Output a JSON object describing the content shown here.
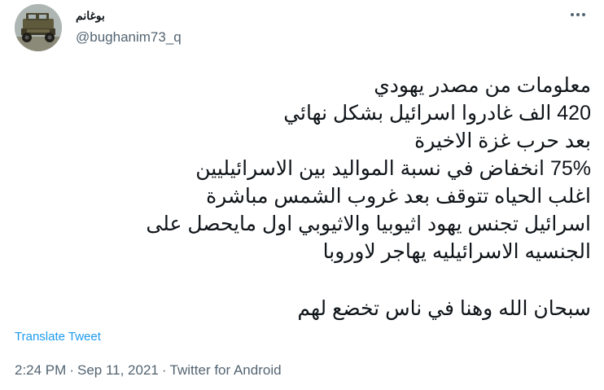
{
  "tweet": {
    "display_name": "بوغانم",
    "handle": "@bughanim73_q",
    "more_icon": "more-horizontal-icon",
    "lines": [
      "معلومات من مصدر يهودي",
      "420 الف غادروا اسرائيل بشكل نهائي",
      "بعد حرب غزة الاخيرة",
      "75% انخفاض في نسبة المواليد بين الاسرائيليين",
      "اغلب الحياه تتوقف بعد غروب الشمس مباشرة",
      "اسرائيل تجنس يهود اثيوبيا والاثيوبي اول مايحصل على",
      "الجنسيه الاسرائيليه يهاجر لاوروبا",
      "سبحان الله وهنا في ناس تخضع لهم"
    ],
    "translate_label": "Translate Tweet",
    "time": "2:24 PM",
    "date": "Sep 11, 2021",
    "source": "Twitter for Android",
    "separator": "·"
  }
}
